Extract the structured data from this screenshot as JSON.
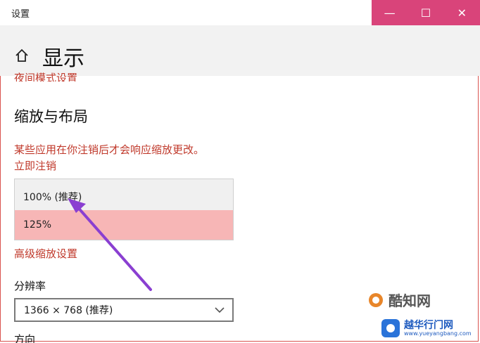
{
  "window": {
    "title": "设置",
    "controls": {
      "minimize": "—",
      "maximize": "☐",
      "close": "✕"
    }
  },
  "header": {
    "page_title": "显示"
  },
  "cut_link": "夜间模式设置",
  "scale_section": {
    "title": "缩放与布局",
    "warning": "某些应用在你注销后才会响应缩放更改。",
    "signout_link": "立即注销",
    "options": [
      "100% (推荐)",
      "125%"
    ],
    "selected_index": 1,
    "advanced_link": "高级缩放设置"
  },
  "resolution": {
    "label": "分辨率",
    "value": "1366 × 768 (推荐)"
  },
  "orientation": {
    "label": "方向"
  },
  "watermarks": {
    "wm1": "酷知网",
    "wm2_main": "越华行门网",
    "wm2_url": "www.yueyangbang.com"
  },
  "colors": {
    "accent_red": "#c0392b",
    "title_bar_controls": "#d9447a",
    "selected_option": "#f7b6b6",
    "arrow": "#8a3fd1"
  }
}
